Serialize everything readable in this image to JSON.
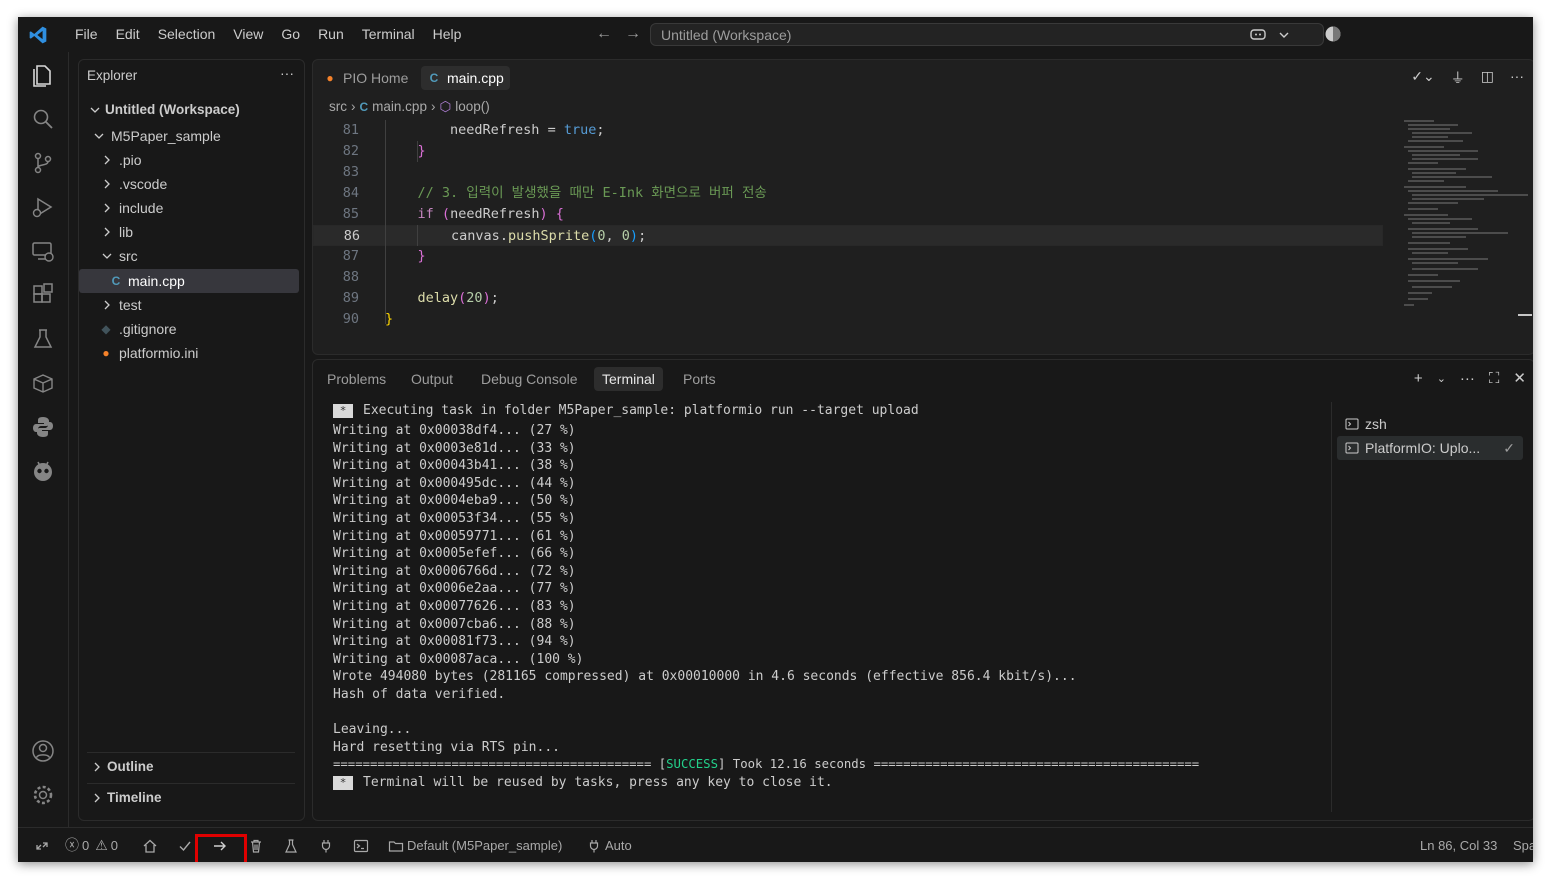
{
  "menu": [
    "File",
    "Edit",
    "Selection",
    "View",
    "Go",
    "Run",
    "Terminal",
    "Help"
  ],
  "command_center": {
    "text": "Untitled (Workspace)"
  },
  "explorer": {
    "title": "Explorer",
    "workspace": "Untitled (Workspace)",
    "project": "M5Paper_sample",
    "items": [
      {
        "label": ".pio",
        "type": "folder"
      },
      {
        "label": ".vscode",
        "type": "folder"
      },
      {
        "label": "include",
        "type": "folder"
      },
      {
        "label": "lib",
        "type": "folder"
      },
      {
        "label": "src",
        "type": "folder-open"
      },
      {
        "label": "main.cpp",
        "type": "file-cpp"
      },
      {
        "label": "test",
        "type": "folder"
      },
      {
        "label": ".gitignore",
        "type": "file-git"
      },
      {
        "label": "platformio.ini",
        "type": "file-pio"
      }
    ],
    "outline": "Outline",
    "timeline": "Timeline"
  },
  "editor": {
    "tabs": [
      {
        "label": "PIO Home",
        "icon": "platformio-icon"
      },
      {
        "label": "main.cpp",
        "icon": "cpp-icon"
      }
    ],
    "breadcrumb": [
      "src",
      "main.cpp",
      "loop()"
    ],
    "lines": [
      {
        "n": "81",
        "text": "        needRefresh = true;"
      },
      {
        "n": "82",
        "text": "    }"
      },
      {
        "n": "83",
        "text": ""
      },
      {
        "n": "84",
        "text": "    // 3. 입력이 발생했을 때만 E-Ink 화면으로 버퍼 전송"
      },
      {
        "n": "85",
        "text": "    if (needRefresh) {"
      },
      {
        "n": "86",
        "text": "        canvas.pushSprite(0, 0);"
      },
      {
        "n": "87",
        "text": "    }"
      },
      {
        "n": "88",
        "text": ""
      },
      {
        "n": "89",
        "text": "    delay(20);"
      },
      {
        "n": "90",
        "text": "}"
      }
    ],
    "current_line": "86"
  },
  "panel": {
    "tabs": [
      "Problems",
      "Output",
      "Debug Console",
      "Terminal",
      "Ports"
    ],
    "active_tab": "Terminal",
    "terminal_lines": [
      "Executing task in folder M5Paper_sample: platformio run --target upload",
      "Writing at 0x00038df4... (27 %)",
      "Writing at 0x0003e81d... (33 %)",
      "Writing at 0x00043b41... (38 %)",
      "Writing at 0x000495dc... (44 %)",
      "Writing at 0x0004eba9... (50 %)",
      "Writing at 0x00053f34... (55 %)",
      "Writing at 0x00059771... (61 %)",
      "Writing at 0x0005efef... (66 %)",
      "Writing at 0x0006766d... (72 %)",
      "Writing at 0x0006e2aa... (77 %)",
      "Writing at 0x00077626... (83 %)",
      "Writing at 0x0007cba6... (88 %)",
      "Writing at 0x00081f73... (94 %)",
      "Writing at 0x00087aca... (100 %)",
      "Wrote 494080 bytes (281165 compressed) at 0x00010000 in 4.6 seconds (effective 856.4 kbit/s)...",
      "Hash of data verified.",
      "",
      "Leaving...",
      "Hard resetting via RTS pin..."
    ],
    "success_line": {
      "left": "=========================================== [",
      "status": "SUCCESS",
      "right": "] Took 12.16 seconds ============================================"
    },
    "reuse_line": "Terminal will be reused by tasks, press any key to close it.",
    "terminals": [
      "zsh",
      "PlatformIO: Uplo..."
    ]
  },
  "statusbar": {
    "errors": "0",
    "warnings": "0",
    "env": "Default (M5Paper_sample)",
    "port": "Auto",
    "position": "Ln 86, Col 33",
    "spaces": "Spa"
  },
  "colors": {
    "accent_blue": "#0078d4",
    "success_green": "#23d18b",
    "highlight_red": "#e00000"
  }
}
